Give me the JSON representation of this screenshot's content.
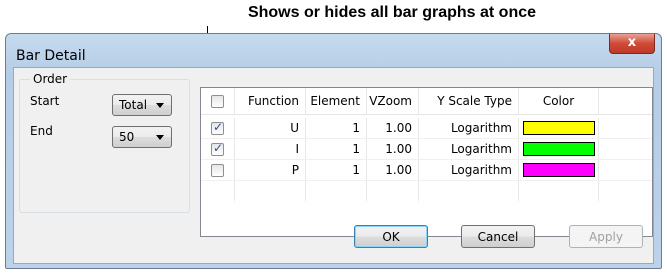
{
  "callout": {
    "text": "Shows or hides all bar graphs at once"
  },
  "window": {
    "title": "Bar Detail",
    "close_label": "x"
  },
  "order": {
    "legend": "Order",
    "start_label": "Start",
    "start_value": "Total",
    "end_label": "End",
    "end_value": "50"
  },
  "table": {
    "headers": {
      "function": "Function",
      "element": "Element",
      "vzoom": "VZoom",
      "yscale": "Y Scale Type",
      "color": "Color"
    },
    "all_checked": false,
    "rows": [
      {
        "checked": true,
        "function": "U",
        "element": "1",
        "vzoom": "1.00",
        "yscale": "Logarithm",
        "color": "#ffff00"
      },
      {
        "checked": true,
        "function": "I",
        "element": "1",
        "vzoom": "1.00",
        "yscale": "Logarithm",
        "color": "#00ff00"
      },
      {
        "checked": false,
        "function": "P",
        "element": "1",
        "vzoom": "1.00",
        "yscale": "Logarithm",
        "color": "#ff00ff"
      }
    ]
  },
  "buttons": {
    "ok": "OK",
    "cancel": "Cancel",
    "apply": "Apply"
  }
}
